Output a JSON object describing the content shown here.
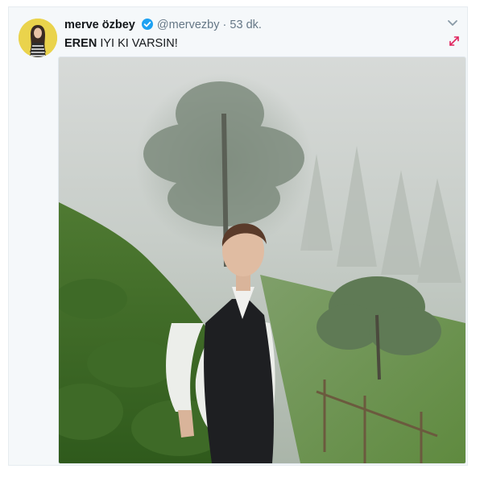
{
  "tweet": {
    "author_name": "merve özbey",
    "handle": "@mervezby",
    "separator": "·",
    "time": "53 dk.",
    "mention": "EREN",
    "text": " IYI KI VARSIN!"
  },
  "icons": {
    "verified": "verified-badge-icon",
    "caret": "chevron-down-icon",
    "expand": "expand-arrows-icon"
  },
  "colors": {
    "verified_blue": "#1da1f2",
    "expand_magenta": "#e0245e",
    "card_bg": "#f5f8fa"
  }
}
